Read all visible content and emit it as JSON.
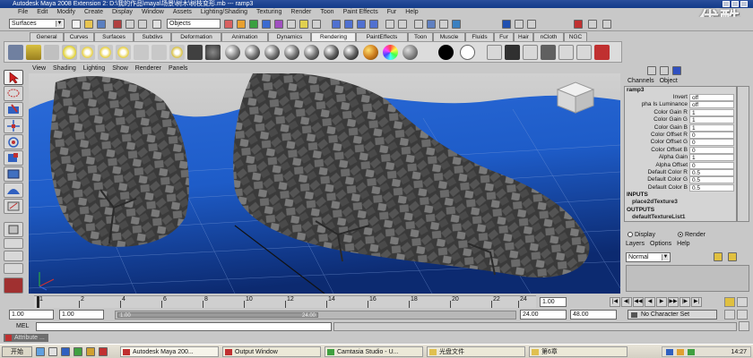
{
  "window": {
    "title": "Autodesk Maya 2008 Extension 2: D:\\我的作品\\maya\\场景\\树木\\树枝变形.mb  ---  ramp3",
    "watermark": "优酷"
  },
  "menubar": [
    "File",
    "Edit",
    "Modify",
    "Create",
    "Display",
    "Window",
    "Assets",
    "Lighting/Shading",
    "Texturing",
    "Render",
    "Toon",
    "Paint Effects",
    "Fur",
    "Help"
  ],
  "statusline": {
    "mode": "Surfaces",
    "object_selector": "Objects"
  },
  "shelf_tabs": [
    "General",
    "Curves",
    "Surfaces",
    "Subdivs",
    "Deformation",
    "Animation",
    "Dynamics",
    "Rendering",
    "PaintEffects",
    "Toon",
    "Muscle",
    "Fluids",
    "Fur",
    "Hair",
    "nCloth",
    "NGC"
  ],
  "active_shelf_tab": "Rendering",
  "panel_menu": [
    "View",
    "Shading",
    "Lighting",
    "Show",
    "Renderer",
    "Panels"
  ],
  "channel_box": {
    "menu": [
      "Channels",
      "Object"
    ],
    "node": "ramp3",
    "attributes": [
      {
        "label": "Invert",
        "value": "off"
      },
      {
        "label": "pha Is Luminance",
        "value": "off"
      },
      {
        "label": "Color Gain R",
        "value": "1"
      },
      {
        "label": "Color Gain G",
        "value": "1"
      },
      {
        "label": "Color Gain B",
        "value": "1"
      },
      {
        "label": "Color Offset R",
        "value": "0"
      },
      {
        "label": "Color Offset G",
        "value": "0"
      },
      {
        "label": "Color Offset B",
        "value": "0"
      },
      {
        "label": "Alpha Gain",
        "value": "1"
      },
      {
        "label": "Alpha Offset",
        "value": "0"
      },
      {
        "label": "Default Color R",
        "value": "0.5"
      },
      {
        "label": "Default Color G",
        "value": "0.5"
      },
      {
        "label": "Default Color B",
        "value": "0.5"
      }
    ],
    "inputs_label": "INPUTS",
    "inputs_node": "place2dTexture3",
    "outputs_label": "OUTPUTS",
    "outputs_node": "defaultTextureList1"
  },
  "layer_editor": {
    "display_label": "Display",
    "render_label": "Render",
    "menu": [
      "Layers",
      "Options",
      "Help"
    ],
    "blend_mode": "Normal"
  },
  "time_slider": {
    "ticks": [
      "1",
      "2",
      "4",
      "6",
      "8",
      "10",
      "12",
      "14",
      "16",
      "18",
      "20",
      "22",
      "24"
    ],
    "current_frame": "1.00"
  },
  "range_slider": {
    "start": "1.00",
    "playback_start": "1.00",
    "playback_end": "24.00",
    "end": "48.00",
    "range_left": "1.00",
    "range_right": "24.00",
    "character_set": "No Character Set"
  },
  "command_line": {
    "label": "MEL"
  },
  "help_line": {
    "label": "Attribute ..."
  },
  "taskbar": {
    "start": "开始",
    "buttons": [
      "Autodesk Maya 200...",
      "Output Window",
      "Camtasia Studio - U...",
      "光盘文件",
      "第6章"
    ],
    "clock": "14:27"
  }
}
